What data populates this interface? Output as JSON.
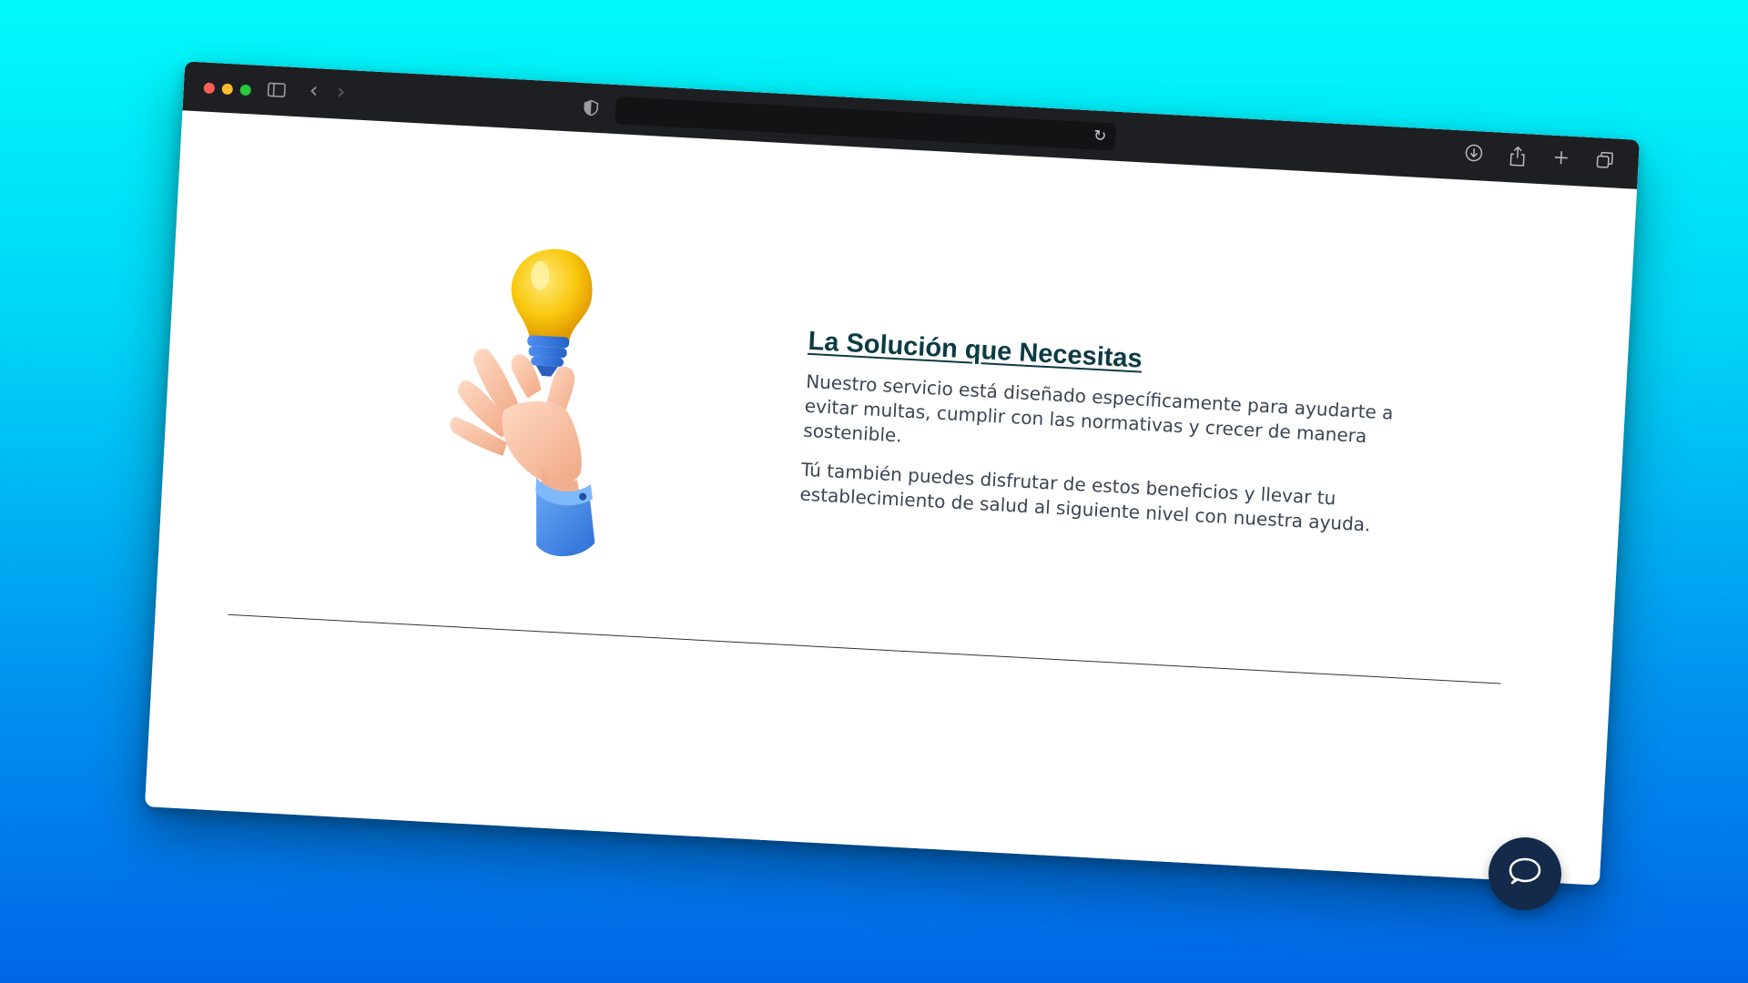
{
  "browser": {
    "toolbar": {
      "icons": [
        "sidebar-icon",
        "back-icon",
        "forward-icon",
        "shield-icon",
        "reload-icon",
        "download-icon",
        "share-icon",
        "new-tab-icon",
        "tabs-overview-icon"
      ],
      "address": ""
    }
  },
  "main": {
    "heading": "La Solución que Necesitas",
    "paragraphs": [
      "Nuestro servicio está diseñado específicamente para ayudarte a evitar multas, cumplir con las normativas y crecer de manera sostenible.",
      "Tú también puedes disfrutar de estos beneficios y llevar tu establecimiento de salud al siguiente nivel con nuestra ayuda."
    ],
    "illustration": "hand-holding-lightbulb"
  },
  "chat": {
    "icon": "chat-bubble-icon"
  },
  "colors": {
    "background_top": "#00fbfb",
    "background_bottom": "#0066e6",
    "heading": "#0d3b44",
    "chat_button": "#142a4b"
  }
}
